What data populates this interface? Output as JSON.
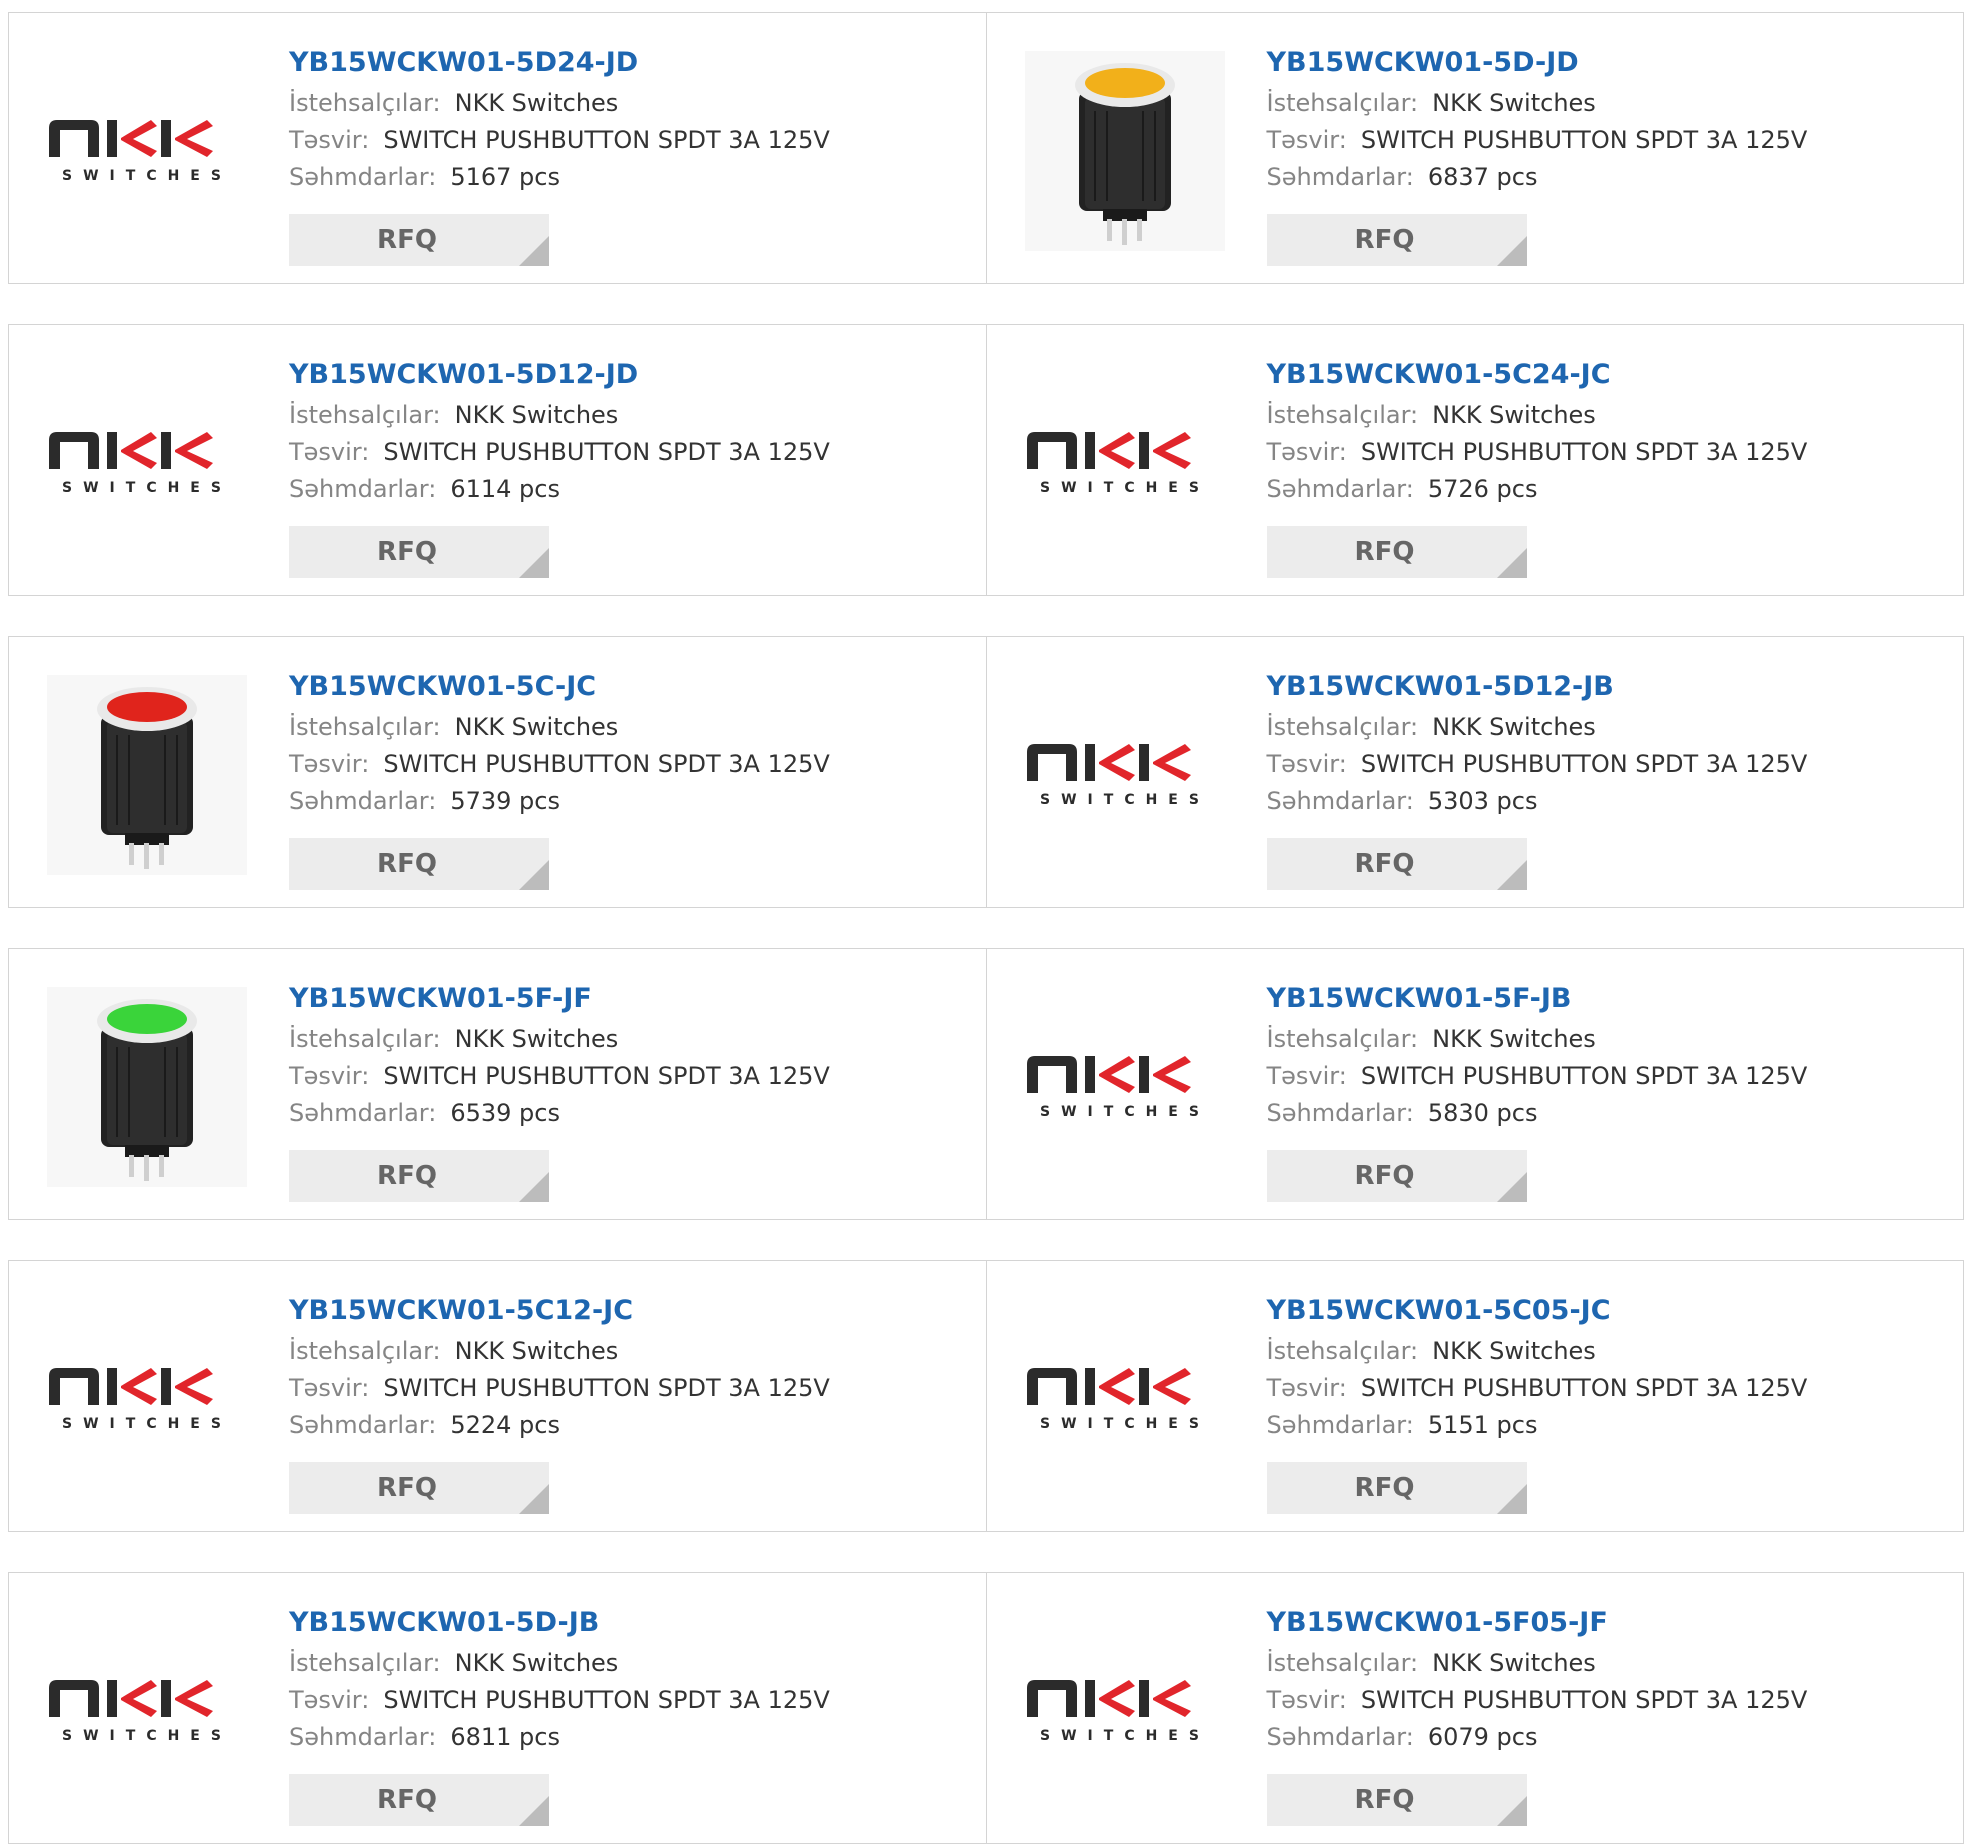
{
  "labels": {
    "manufacturer": "İstehsalçılar:",
    "description": "Təsvir:",
    "stock": "Səhmdarlar:",
    "rfq": "RFQ"
  },
  "logo": {
    "brand": "NKK",
    "sub": "SWITCHES"
  },
  "colors": {
    "title": "#1e66b0",
    "button_bg": "#ececec",
    "logo_dark": "#2b2b2b",
    "logo_red": "#e1252b"
  },
  "products": [
    {
      "part": "YB15WCKW01-5D24-JD",
      "manufacturer": "NKK Switches",
      "description": "SWITCH PUSHBUTTON SPDT 3A 125V",
      "stock": "5167 pcs",
      "image": "nkk-logo"
    },
    {
      "part": "YB15WCKW01-5D-JD",
      "manufacturer": "NKK Switches",
      "description": "SWITCH PUSHBUTTON SPDT 3A 125V",
      "stock": "6837 pcs",
      "image": "pushbutton",
      "lens_color": "#f2b01a"
    },
    {
      "part": "YB15WCKW01-5D12-JD",
      "manufacturer": "NKK Switches",
      "description": "SWITCH PUSHBUTTON SPDT 3A 125V",
      "stock": "6114 pcs",
      "image": "nkk-logo"
    },
    {
      "part": "YB15WCKW01-5C24-JC",
      "manufacturer": "NKK Switches",
      "description": "SWITCH PUSHBUTTON SPDT 3A 125V",
      "stock": "5726 pcs",
      "image": "nkk-logo"
    },
    {
      "part": "YB15WCKW01-5C-JC",
      "manufacturer": "NKK Switches",
      "description": "SWITCH PUSHBUTTON SPDT 3A 125V",
      "stock": "5739 pcs",
      "image": "pushbutton",
      "lens_color": "#e0241c"
    },
    {
      "part": "YB15WCKW01-5D12-JB",
      "manufacturer": "NKK Switches",
      "description": "SWITCH PUSHBUTTON SPDT 3A 125V",
      "stock": "5303 pcs",
      "image": "nkk-logo"
    },
    {
      "part": "YB15WCKW01-5F-JF",
      "manufacturer": "NKK Switches",
      "description": "SWITCH PUSHBUTTON SPDT 3A 125V",
      "stock": "6539 pcs",
      "image": "pushbutton",
      "lens_color": "#3ad43a"
    },
    {
      "part": "YB15WCKW01-5F-JB",
      "manufacturer": "NKK Switches",
      "description": "SWITCH PUSHBUTTON SPDT 3A 125V",
      "stock": "5830 pcs",
      "image": "nkk-logo"
    },
    {
      "part": "YB15WCKW01-5C12-JC",
      "manufacturer": "NKK Switches",
      "description": "SWITCH PUSHBUTTON SPDT 3A 125V",
      "stock": "5224 pcs",
      "image": "nkk-logo"
    },
    {
      "part": "YB15WCKW01-5C05-JC",
      "manufacturer": "NKK Switches",
      "description": "SWITCH PUSHBUTTON SPDT 3A 125V",
      "stock": "5151 pcs",
      "image": "nkk-logo"
    },
    {
      "part": "YB15WCKW01-5D-JB",
      "manufacturer": "NKK Switches",
      "description": "SWITCH PUSHBUTTON SPDT 3A 125V",
      "stock": "6811 pcs",
      "image": "nkk-logo"
    },
    {
      "part": "YB15WCKW01-5F05-JF",
      "manufacturer": "NKK Switches",
      "description": "SWITCH PUSHBUTTON SPDT 3A 125V",
      "stock": "6079 pcs",
      "image": "nkk-logo"
    }
  ]
}
